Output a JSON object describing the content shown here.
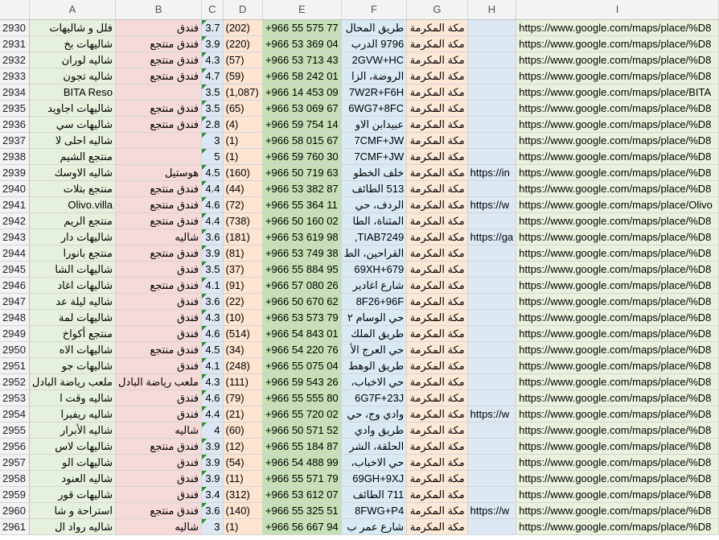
{
  "columns": [
    "A",
    "B",
    "C",
    "D",
    "E",
    "F",
    "G",
    "H",
    "I"
  ],
  "rows": [
    {
      "n": "2930",
      "a": "فلل و شاليهات",
      "b": "فندق",
      "c": "3.7",
      "d": "(202)",
      "e": "+966 55 575 77",
      "f": "طريق المحال",
      "g": "مكة المكرمة",
      "h": "",
      "i": "https://www.google.com/maps/place/%D8"
    },
    {
      "n": "2931",
      "a": "شاليهات بخ",
      "b": "فندق منتجع",
      "c": "3.9",
      "d": "(220)",
      "e": "+966 53 369 04",
      "f": "9796 الدرب",
      "g": "مكة المكرمة",
      "h": "",
      "i": "https://www.google.com/maps/place/%D8"
    },
    {
      "n": "2932",
      "a": "شاليه لوران",
      "b": "فندق منتجع",
      "c": "4.3",
      "d": "(57)",
      "e": "+966 53 713 43",
      "f": "2GVW+HC",
      "g": "مكة المكرمة",
      "h": "",
      "i": "https://www.google.com/maps/place/%D8"
    },
    {
      "n": "2933",
      "a": "شاليه تجون",
      "b": "فندق منتجع",
      "c": "4.7",
      "d": "(59)",
      "e": "+966 58 242 01",
      "f": "الروضة، الزا",
      "g": "مكة المكرمة",
      "h": "",
      "i": "https://www.google.com/maps/place/%D8"
    },
    {
      "n": "2934",
      "a": "BITA Reso",
      "b": "",
      "c": "3.5",
      "d": "(1,087)",
      "e": "+966 14 453 09",
      "f": "7W2R+F6H",
      "g": "مكة المكرمة",
      "h": "",
      "i": "https://www.google.com/maps/place/BITA"
    },
    {
      "n": "2935",
      "a": "شاليهات اجاويد",
      "b": "فندق منتجع",
      "c": "3.5",
      "d": "(65)",
      "e": "+966 53 069 67",
      "f": "6WG7+8FC",
      "g": "مكة المكرمة",
      "h": "",
      "i": "https://www.google.com/maps/place/%D8"
    },
    {
      "n": "2936",
      "a": "شاليهات سي",
      "b": "فندق منتجع",
      "c": "2.8",
      "d": "(4)",
      "e": "+966 59 754 14",
      "f": "عبيدابن الاو",
      "g": "مكة المكرمة",
      "h": "",
      "i": "https://www.google.com/maps/place/%D8"
    },
    {
      "n": "2937",
      "a": "شاليه احلى لا",
      "b": "",
      "c": "3",
      "d": "(1)",
      "e": "+966 58 015 67",
      "f": "7CMF+JW",
      "g": "مكة المكرمة",
      "h": "",
      "i": "https://www.google.com/maps/place/%D8"
    },
    {
      "n": "2938",
      "a": "منتجع الشيم",
      "b": "",
      "c": "5",
      "d": "(1)",
      "e": "+966 59 760 30",
      "f": "7CMF+JW",
      "g": "مكة المكرمة",
      "h": "",
      "i": "https://www.google.com/maps/place/%D8"
    },
    {
      "n": "2939",
      "a": "شاليه الاوسك",
      "b": "هوستيل",
      "c": "4.5",
      "d": "(160)",
      "e": "+966 50 719 63",
      "f": "خلف الخطو",
      "g": "مكة المكرمة",
      "h": "https://in",
      "i": "https://www.google.com/maps/place/%D8"
    },
    {
      "n": "2940",
      "a": "منتجع بتلات",
      "b": "فندق منتجع",
      "c": "4.4",
      "d": "(44)",
      "e": "+966 53 382 87",
      "f": "513 الطائف",
      "g": "مكة المكرمة",
      "h": "",
      "i": "https://www.google.com/maps/place/%D8"
    },
    {
      "n": "2941",
      "a": "Olivo.villa",
      "b": "فندق منتجع",
      "c": "4.6",
      "d": "(72)",
      "e": "+966 55 364 11",
      "f": "الردف، حي",
      "g": "مكة المكرمة",
      "h": "https://w",
      "i": "https://www.google.com/maps/place/Olivo"
    },
    {
      "n": "2942",
      "a": "منتجع الريم",
      "b": "فندق منتجع",
      "c": "4.4",
      "d": "(738)",
      "e": "+966 50 160 02",
      "f": "المثناة، الطا",
      "g": "مكة المكرمة",
      "h": "",
      "i": "https://www.google.com/maps/place/%D8"
    },
    {
      "n": "2943",
      "a": "شاليهات دار",
      "b": "شاليه",
      "c": "3.6",
      "d": "(181)",
      "e": "+966 53 619 98",
      "f": "TIAB7249,",
      "g": "مكة المكرمة",
      "h": "https://ga",
      "i": "https://www.google.com/maps/place/%D8"
    },
    {
      "n": "2944",
      "a": "منتجع بانورا",
      "b": "فندق منتجع",
      "c": "3.9",
      "d": "(81)",
      "e": "+966 53 749 38",
      "f": "القراحين، الط",
      "g": "مكة المكرمة",
      "h": "",
      "i": "https://www.google.com/maps/place/%D8"
    },
    {
      "n": "2945",
      "a": "شاليهات الشا",
      "b": "فندق",
      "c": "3.5",
      "d": "(37)",
      "e": "+966 55 884 95",
      "f": "69XH+679",
      "g": "مكة المكرمة",
      "h": "",
      "i": "https://www.google.com/maps/place/%D8"
    },
    {
      "n": "2946",
      "a": "شاليهات اغاد",
      "b": "فندق منتجع",
      "c": "4.1",
      "d": "(91)",
      "e": "+966 57 080 26",
      "f": "شارع اغادير",
      "g": "مكة المكرمة",
      "h": "",
      "i": "https://www.google.com/maps/place/%D8"
    },
    {
      "n": "2947",
      "a": "شاليه ليلة عد",
      "b": "فندق",
      "c": "3.6",
      "d": "(22)",
      "e": "+966 50 670 62",
      "f": "8F26+96F",
      "g": "مكة المكرمة",
      "h": "",
      "i": "https://www.google.com/maps/place/%D8"
    },
    {
      "n": "2948",
      "a": "شاليهات لمة",
      "b": "فندق",
      "c": "4.3",
      "d": "(10)",
      "e": "+966 53 573 79",
      "f": "حي الوسام ٢",
      "g": "مكة المكرمة",
      "h": "",
      "i": "https://www.google.com/maps/place/%D8"
    },
    {
      "n": "2949",
      "a": "منتجع أكواخ",
      "b": "فندق",
      "c": "4.6",
      "d": "(514)",
      "e": "+966 54 843 01",
      "f": "طريق الملك",
      "g": "مكة المكرمة",
      "h": "",
      "i": "https://www.google.com/maps/place/%D8"
    },
    {
      "n": "2950",
      "a": "شاليهات الاه",
      "b": "فندق منتجع",
      "c": "4.5",
      "d": "(34)",
      "e": "+966 54 220 76",
      "f": "حي العرج الأ",
      "g": "مكة المكرمة",
      "h": "",
      "i": "https://www.google.com/maps/place/%D8"
    },
    {
      "n": "2951",
      "a": "شاليهات جو",
      "b": "فندق",
      "c": "4.1",
      "d": "(248)",
      "e": "+966 55 075 04",
      "f": "طريق الوهط",
      "g": "مكة المكرمة",
      "h": "",
      "i": "https://www.google.com/maps/place/%D8"
    },
    {
      "n": "2952",
      "a": "ملعب رياضة البادل",
      "b": "ملعب رياضة البادل",
      "c": "4.3",
      "d": "(111)",
      "e": "+966 59 543 26",
      "f": "حي الاخباب،",
      "g": "مكة المكرمة",
      "h": "",
      "i": "https://www.google.com/maps/place/%D8"
    },
    {
      "n": "2953",
      "a": "شاليه وقت ا",
      "b": "فندق",
      "c": "4.6",
      "d": "(79)",
      "e": "+966 55 555 80",
      "f": "6G7F+23J",
      "g": "مكة المكرمة",
      "h": "",
      "i": "https://www.google.com/maps/place/%D8"
    },
    {
      "n": "2954",
      "a": "شاليه ريفيرا",
      "b": "فندق",
      "c": "4.4",
      "d": "(21)",
      "e": "+966 55 720 02",
      "f": "وادي وج، حي",
      "g": "مكة المكرمة",
      "h": "https://w",
      "i": "https://www.google.com/maps/place/%D8"
    },
    {
      "n": "2955",
      "a": "شاليه الأبرار",
      "b": "شاليه",
      "c": "4",
      "d": "(60)",
      "e": "+966 50 571 52",
      "f": "طريق وادي",
      "g": "مكة المكرمة",
      "h": "",
      "i": "https://www.google.com/maps/place/%D8"
    },
    {
      "n": "2956",
      "a": "شاليهات لاس",
      "b": "فندق منتجع",
      "c": "3.9",
      "d": "(12)",
      "e": "+966 55 184 87",
      "f": "الحلقة، الشر",
      "g": "مكة المكرمة",
      "h": "",
      "i": "https://www.google.com/maps/place/%D8"
    },
    {
      "n": "2957",
      "a": "شاليهات الو",
      "b": "فندق",
      "c": "3.9",
      "d": "(54)",
      "e": "+966 54 488 99",
      "f": "حي الاخباب،",
      "g": "مكة المكرمة",
      "h": "",
      "i": "https://www.google.com/maps/place/%D8"
    },
    {
      "n": "2958",
      "a": "شاليه العنود",
      "b": "فندق",
      "c": "3.9",
      "d": "(11)",
      "e": "+966 55 571 79",
      "f": "69GH+9XJ",
      "g": "مكة المكرمة",
      "h": "",
      "i": "https://www.google.com/maps/place/%D8"
    },
    {
      "n": "2959",
      "a": "شاليهات قور",
      "b": "فندق",
      "c": "3.4",
      "d": "(312)",
      "e": "+966 53 612 07",
      "f": "711 الطائف",
      "g": "مكة المكرمة",
      "h": "",
      "i": "https://www.google.com/maps/place/%D8"
    },
    {
      "n": "2960",
      "a": "استراحة و شا",
      "b": "فندق منتجع",
      "c": "3.6",
      "d": "(140)",
      "e": "+966 55 325 51",
      "f": "8FWG+P4",
      "g": "مكة المكرمة",
      "h": "https://w",
      "i": "https://www.google.com/maps/place/%D8"
    },
    {
      "n": "2961",
      "a": "شاليه رواد ال",
      "b": "شاليه",
      "c": "3",
      "d": "(1)",
      "e": "+966 56 667 94",
      "f": "شارع عمر ب",
      "g": "مكة المكرمة",
      "h": "",
      "i": "https://www.google.com/maps/place/%D8"
    }
  ]
}
